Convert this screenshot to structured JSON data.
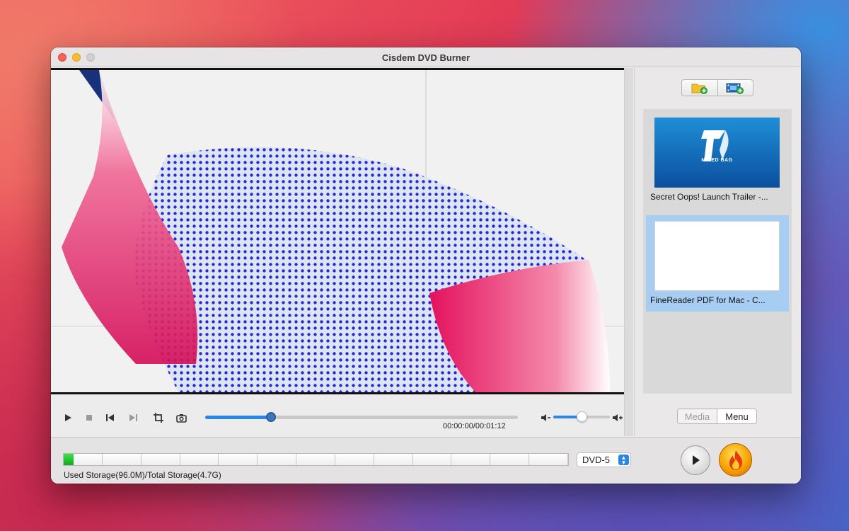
{
  "window": {
    "title": "Cisdem DVD Burner"
  },
  "icons": {
    "close": "close-icon",
    "minimize": "minimize-icon",
    "maximize": "maximize-icon",
    "add_folder": "folder-add-icon",
    "add_video": "film-add-icon",
    "play": "play-icon",
    "stop": "stop-icon",
    "prev": "skip-previous-icon",
    "next": "skip-next-icon",
    "crop": "crop-icon",
    "snapshot": "camera-icon",
    "volume_down": "volume-down-icon",
    "volume_up": "volume-up-icon",
    "dropdown": "chevron-updown-icon",
    "burn": "flame-icon"
  },
  "player": {
    "timecode": "00:00:00/00:01:12",
    "progress_fraction": 0.21,
    "volume_fraction": 0.5
  },
  "media_list": {
    "items": [
      {
        "label": "Secret Oops! Launch Trailer -...",
        "thumb_text": "MIXED BAG",
        "selected": false
      },
      {
        "label": "FineReader PDF for Mac - C...",
        "selected": true
      }
    ]
  },
  "tabs": {
    "media": "Media",
    "menu": "Menu",
    "active": "menu"
  },
  "storage": {
    "text": "Used Storage(96.0M)/Total Storage(4.7G)",
    "used_fraction": 0.02,
    "segments": 13,
    "disc_type": "DVD-5"
  },
  "colors": {
    "accent": "#2b86e6",
    "selection": "#a8cdf3",
    "storage_used": "#1fc432"
  }
}
